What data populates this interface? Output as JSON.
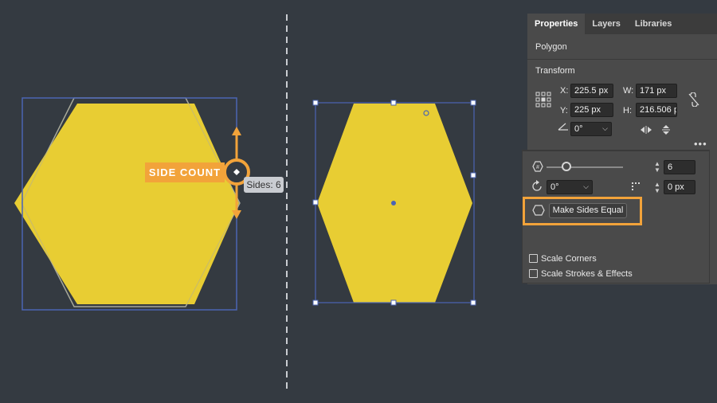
{
  "callout": {
    "label": "SIDE COUNT"
  },
  "tooltip": {
    "text": "Sides: 6"
  },
  "colors": {
    "shape_fill": "#e8cd33",
    "accent": "#f2a33a",
    "selection": "#4b64b3"
  },
  "panel": {
    "tabs": [
      {
        "label": "Properties"
      },
      {
        "label": "Layers"
      },
      {
        "label": "Libraries"
      }
    ],
    "object_type": "Polygon",
    "transform": {
      "title": "Transform",
      "x_label": "X:",
      "x_value": "225.5 px",
      "y_label": "Y:",
      "y_value": "225 px",
      "w_label": "W:",
      "w_value": "171 px",
      "h_label": "H:",
      "h_value": "216.506 p",
      "rotation_value": "0°"
    },
    "more_icon": "ellipsis-icon"
  },
  "polygon": {
    "side_count_value": "6",
    "rotation_value": "0°",
    "corner_radius_value": "0 px",
    "make_sides_equal_label": "Make Sides Equal",
    "scale_corners_label": "Scale Corners",
    "scale_strokes_label": "Scale Strokes & Effects",
    "scale_corners_checked": false,
    "scale_strokes_checked": false
  }
}
